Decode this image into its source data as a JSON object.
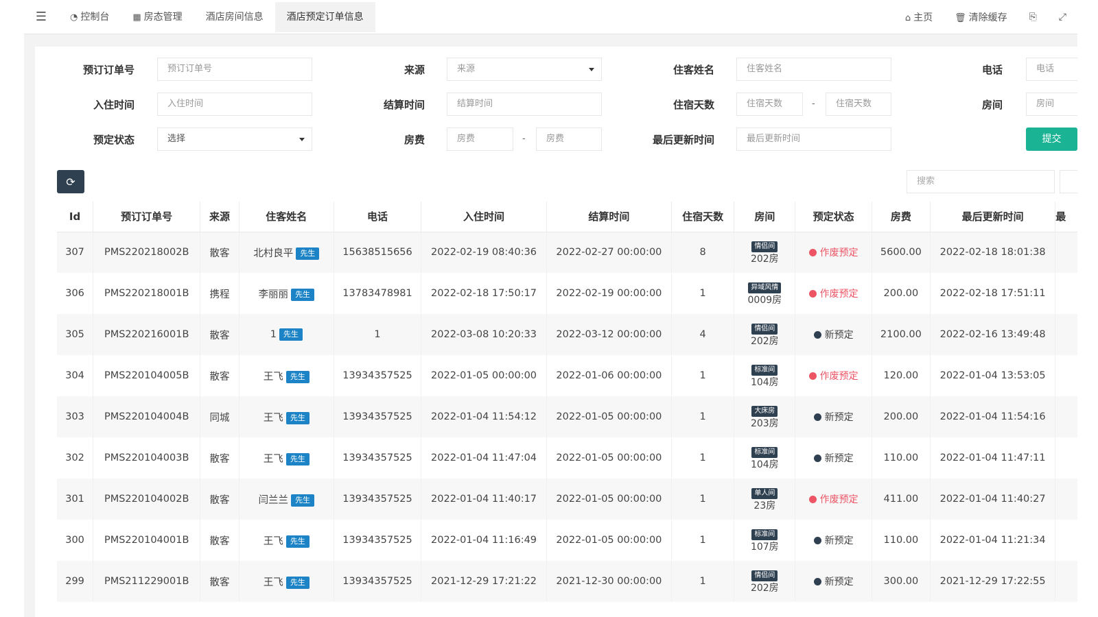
{
  "topnav": {
    "tabs": [
      {
        "label": "控制台",
        "icon": "dashboard-icon",
        "glyph": "◔"
      },
      {
        "label": "房态管理",
        "icon": "calendar-icon",
        "glyph": "▦"
      },
      {
        "label": "酒店房间信息",
        "icon": "",
        "glyph": ""
      },
      {
        "label": "酒店预定订单信息",
        "icon": "",
        "glyph": ""
      }
    ],
    "active_tab": 3,
    "home_label": "主页",
    "clear_cache_label": "清除缓存"
  },
  "search_form": {
    "order_no": {
      "label": "预订订单号",
      "placeholder": "预订订单号"
    },
    "source": {
      "label": "来源",
      "value": "来源"
    },
    "guest_name": {
      "label": "住客姓名",
      "placeholder": "住客姓名"
    },
    "phone": {
      "label": "电话",
      "placeholder": "电话"
    },
    "checkin": {
      "label": "入住时间",
      "placeholder": "入住时间"
    },
    "checkout": {
      "label": "结算时间",
      "placeholder": "结算时间"
    },
    "days": {
      "label": "住宿天数",
      "placeholder_from": "住宿天数",
      "placeholder_to": "住宿天数"
    },
    "room": {
      "label": "房间",
      "placeholder": "房间"
    },
    "status": {
      "label": "预定状态",
      "value": "选择"
    },
    "fee": {
      "label": "房费",
      "placeholder_from": "房费",
      "placeholder_to": "房费"
    },
    "updated": {
      "label": "最后更新时间",
      "placeholder": "最后更新时间"
    },
    "range_sep": "-",
    "submit_label": "提交"
  },
  "toolbar": {
    "search_placeholder": "搜索"
  },
  "table": {
    "headers": [
      "Id",
      "预订订单号",
      "来源",
      "住客姓名",
      "电话",
      "入住时间",
      "结算时间",
      "住宿天数",
      "房间",
      "预定状态",
      "房费",
      "最后更新时间",
      "最"
    ],
    "rows": [
      {
        "id": "307",
        "order_no": "PMS220218002B",
        "source": "散客",
        "name": "北村良平",
        "gender": "先生",
        "phone": "15638515656",
        "checkin": "2022-02-19 08:40:36",
        "checkout": "2022-02-27 00:00:00",
        "days": "8",
        "room_type": "情侣间",
        "room_no": "202房",
        "status": "作废预定",
        "fee": "5600.00",
        "updated": "2022-02-18 18:01:38"
      },
      {
        "id": "306",
        "order_no": "PMS220218001B",
        "source": "携程",
        "name": "李丽丽",
        "gender": "先生",
        "phone": "13783478981",
        "checkin": "2022-02-18 17:50:17",
        "checkout": "2022-02-19 00:00:00",
        "days": "1",
        "room_type": "异域风情",
        "room_no": "0009房",
        "status": "作废预定",
        "fee": "200.00",
        "updated": "2022-02-18 17:51:11"
      },
      {
        "id": "305",
        "order_no": "PMS220216001B",
        "source": "散客",
        "name": "1",
        "gender": "先生",
        "phone": "1",
        "checkin": "2022-03-08 10:20:33",
        "checkout": "2022-03-12 00:00:00",
        "days": "4",
        "room_type": "情侣间",
        "room_no": "202房",
        "status": "新预定",
        "fee": "2100.00",
        "updated": "2022-02-16 13:49:48"
      },
      {
        "id": "304",
        "order_no": "PMS220104005B",
        "source": "散客",
        "name": "王飞",
        "gender": "先生",
        "phone": "13934357525",
        "checkin": "2022-01-05 00:00:00",
        "checkout": "2022-01-06 00:00:00",
        "days": "1",
        "room_type": "标准间",
        "room_no": "104房",
        "status": "作废预定",
        "fee": "120.00",
        "updated": "2022-01-04 13:53:05"
      },
      {
        "id": "303",
        "order_no": "PMS220104004B",
        "source": "同城",
        "name": "王飞",
        "gender": "先生",
        "phone": "13934357525",
        "checkin": "2022-01-04 11:54:12",
        "checkout": "2022-01-05 00:00:00",
        "days": "1",
        "room_type": "大床房",
        "room_no": "203房",
        "status": "新预定",
        "fee": "200.00",
        "updated": "2022-01-04 11:54:16"
      },
      {
        "id": "302",
        "order_no": "PMS220104003B",
        "source": "散客",
        "name": "王飞",
        "gender": "先生",
        "phone": "13934357525",
        "checkin": "2022-01-04 11:47:04",
        "checkout": "2022-01-05 00:00:00",
        "days": "1",
        "room_type": "标准间",
        "room_no": "104房",
        "status": "新预定",
        "fee": "110.00",
        "updated": "2022-01-04 11:47:11"
      },
      {
        "id": "301",
        "order_no": "PMS220104002B",
        "source": "散客",
        "name": "闫兰兰",
        "gender": "先生",
        "phone": "13934357525",
        "checkin": "2022-01-04 11:40:17",
        "checkout": "2022-01-05 00:00:00",
        "days": "1",
        "room_type": "单人间",
        "room_no": "23房",
        "status": "作废预定",
        "fee": "411.00",
        "updated": "2022-01-04 11:40:27"
      },
      {
        "id": "300",
        "order_no": "PMS220104001B",
        "source": "散客",
        "name": "王飞",
        "gender": "先生",
        "phone": "13934357525",
        "checkin": "2022-01-04 11:16:49",
        "checkout": "2022-01-05 00:00:00",
        "days": "1",
        "room_type": "标准间",
        "room_no": "107房",
        "status": "新预定",
        "fee": "110.00",
        "updated": "2022-01-04 11:21:34"
      },
      {
        "id": "299",
        "order_no": "PMS211229001B",
        "source": "散客",
        "name": "王飞",
        "gender": "先生",
        "phone": "13934357525",
        "checkin": "2021-12-29 17:21:22",
        "checkout": "2021-12-30 00:00:00",
        "days": "1",
        "room_type": "情侣间",
        "room_no": "202房",
        "status": "新预定",
        "fee": "300.00",
        "updated": "2021-12-29 17:22:55"
      }
    ]
  },
  "colors": {
    "cancelled": "#ed5565",
    "new": "#2f4050",
    "gender_badge": "#1c84c6",
    "room_badge": "#2f4050",
    "submit": "#1ab394"
  }
}
